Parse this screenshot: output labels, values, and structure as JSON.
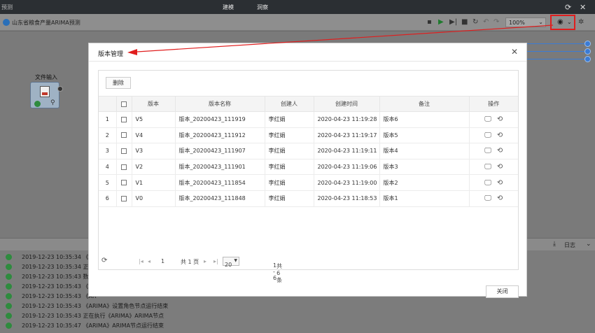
{
  "topbar": {
    "left_title": "预测",
    "tabs": [
      {
        "label": "建模"
      },
      {
        "label": "洞察"
      }
    ],
    "icons": [
      "refresh-icon",
      "close-icon"
    ]
  },
  "subbar": {
    "project_title": "山东省粮食产量ARIMA预测",
    "zoom": "100%",
    "icons": [
      "save-icon",
      "run-icon",
      "step-run-icon",
      "stop-icon",
      "reset-icon",
      "undo-icon",
      "redo-icon",
      "camera-icon",
      "gear-icon"
    ]
  },
  "canvas": {
    "node_label": "文件输入"
  },
  "logbar": {
    "label": "日志"
  },
  "logs": [
    {
      "text": "2019-12-23 10:35:34 《AR"
    },
    {
      "text": "2019-12-23 10:35:34 正在"
    },
    {
      "text": "2019-12-23 10:35:43 数据"
    },
    {
      "text": "2019-12-23 10:35:43 《AR"
    },
    {
      "text": "2019-12-23 10:35:43 《AR"
    },
    {
      "text": "2019-12-23 10:35:43 《ARIMA》设置角色节点运行结束"
    },
    {
      "text": "2019-12-23 10:35:43 正在执行《ARIMA》ARIMA节点"
    },
    {
      "text": "2019-12-23 10:35:47 《ARIMA》ARIMA节点运行结束"
    }
  ],
  "modal": {
    "title": "版本管理",
    "delete_label": "删除",
    "close_label": "关闭",
    "columns": [
      "",
      "",
      "版本",
      "版本名称",
      "创建人",
      "创建时间",
      "备注",
      "操作"
    ],
    "rows": [
      {
        "idx": "1",
        "version": "V5",
        "name": "版本_20200423_111919",
        "creator": "李红娟",
        "time": "2020-04-23 11:19:28",
        "remark": "版本6"
      },
      {
        "idx": "2",
        "version": "V4",
        "name": "版本_20200423_111912",
        "creator": "李红娟",
        "time": "2020-04-23 11:19:17",
        "remark": "版本5"
      },
      {
        "idx": "3",
        "version": "V3",
        "name": "版本_20200423_111907",
        "creator": "李红娟",
        "time": "2020-04-23 11:19:11",
        "remark": "版本4"
      },
      {
        "idx": "4",
        "version": "V2",
        "name": "版本_20200423_111901",
        "creator": "李红娟",
        "time": "2020-04-23 11:19:06",
        "remark": "版本3"
      },
      {
        "idx": "5",
        "version": "V1",
        "name": "版本_20200423_111854",
        "creator": "李红娟",
        "time": "2020-04-23 11:19:00",
        "remark": "版本2"
      },
      {
        "idx": "6",
        "version": "V0",
        "name": "版本_20200423_111848",
        "creator": "李红娟",
        "time": "2020-04-23 11:18:53",
        "remark": "版本1"
      }
    ],
    "pager": {
      "page": "1",
      "total_pages": "共 1 页",
      "page_size": "20",
      "range": "1 - 6",
      "total": "共 6 条"
    }
  },
  "colors": {
    "annotation_red": "#e01e1e",
    "link_blue": "#3b7bd4",
    "success_green": "#2e8b3e"
  }
}
